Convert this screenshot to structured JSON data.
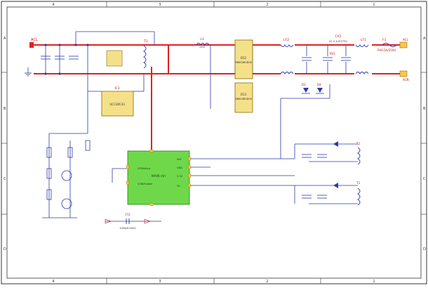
{
  "frame": {
    "col_labels": [
      "4",
      "3",
      "2",
      "1"
    ],
    "row_labels": [
      "A",
      "B",
      "C",
      "D"
    ]
  },
  "inputs": {
    "ac_l": "ACL",
    "ac_n": "ACN",
    "fuse_ref": "F1",
    "fuse_value": "FH0.5A/250V"
  },
  "emi": {
    "cx2_ref": "CX1",
    "cx2_value": "X2 0.1uF/275V",
    "lf2_ref": "LF2",
    "lf1_ref": "LF1",
    "rv_ref": "RV1"
  },
  "rectifier": {
    "bridge1": "D12",
    "bridge1_part": "MB6S/BRIDGE",
    "bridge2": "D13",
    "bridge2_part": "MB6S/BRIDGE",
    "inductor": "L1",
    "inductor_value": "1mH"
  },
  "controller": {
    "ic_ref": "IC1",
    "ic_part": "UCC28C43",
    "transformer": "T1"
  },
  "mcu": {
    "name": "MAIN ctrl",
    "pin_left_1": "OP/Rollout",
    "pin_left_2": "V/SB/Enable",
    "pin_right_1": "VIN",
    "pin_right_2": "GND",
    "pin_right_3": "3.3V",
    "pin_right_4": "5V"
  },
  "right_secondary": {
    "d_ref": "D3",
    "d_ref2": "D4",
    "t_ref": "T2",
    "t_ref2": "T3"
  },
  "bottom_cap": {
    "ref": "CY2",
    "value": "1000pF/400V"
  }
}
